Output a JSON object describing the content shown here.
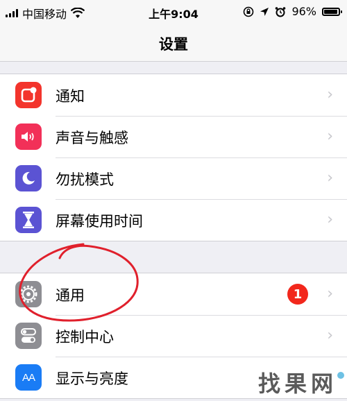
{
  "status_bar": {
    "carrier": "中国移动",
    "time": "上午9:04",
    "battery_percent": "96%",
    "battery_level": 0.96,
    "icons": [
      "signal-icon",
      "wifi-icon",
      "orientation-lock-icon",
      "location-icon",
      "alarm-icon",
      "battery-icon"
    ]
  },
  "nav": {
    "title": "设置"
  },
  "groups": [
    {
      "rows": [
        {
          "label": "通知",
          "icon": "notifications-icon",
          "icon_color": "#f3342c"
        },
        {
          "label": "声音与触感",
          "icon": "sounds-icon",
          "icon_color": "#f23058"
        },
        {
          "label": "勿扰模式",
          "icon": "do-not-disturb-icon",
          "icon_color": "#5b53d3"
        },
        {
          "label": "屏幕使用时间",
          "icon": "screen-time-icon",
          "icon_color": "#5b53d3"
        }
      ]
    },
    {
      "rows": [
        {
          "label": "通用",
          "icon": "general-gear-icon",
          "icon_color": "#8e8e93",
          "badge": "1"
        },
        {
          "label": "控制中心",
          "icon": "control-center-icon",
          "icon_color": "#8e8e93"
        },
        {
          "label": "显示与亮度",
          "icon": "display-brightness-icon",
          "icon_color": "#1a7cf5",
          "icon_text": "AA"
        }
      ]
    }
  ],
  "chevron": "›",
  "badge_color": "#f2271c",
  "annotation_color": "#e0202c",
  "watermark": "找果网"
}
